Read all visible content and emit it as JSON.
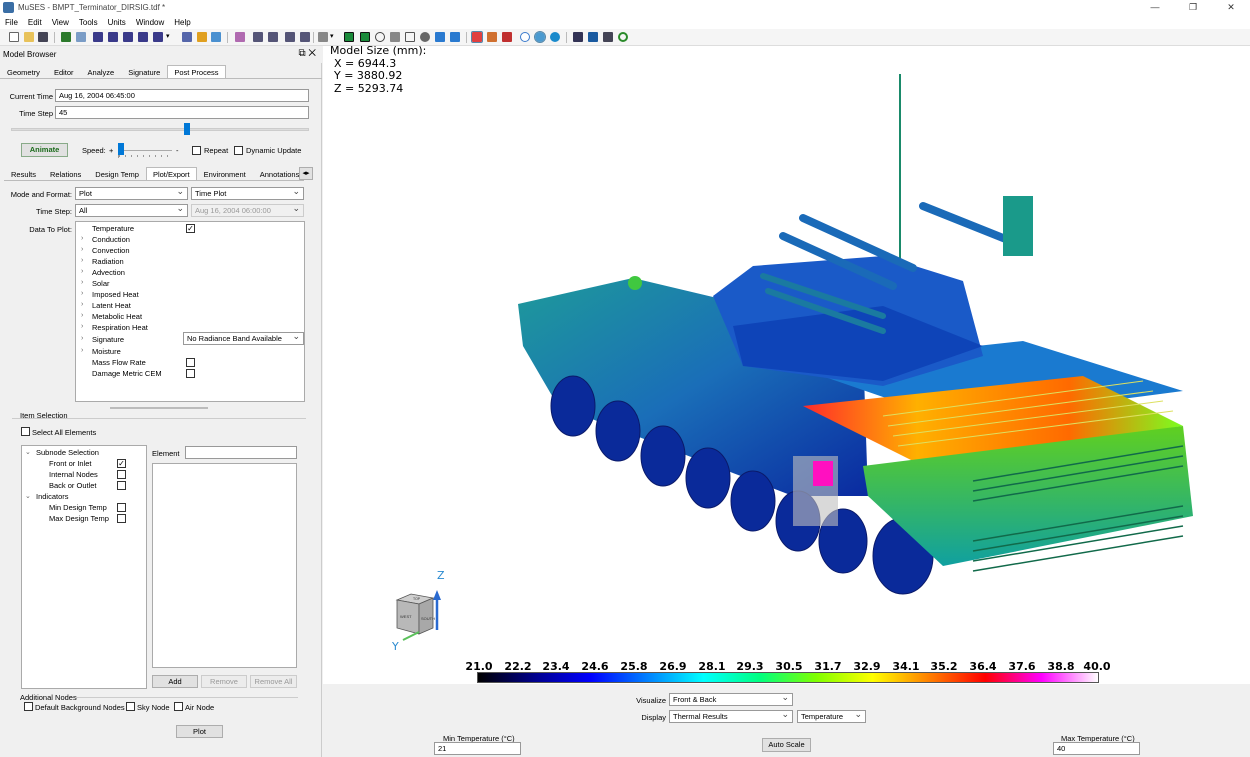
{
  "window": {
    "app_name": "MuSES",
    "title": "MuSES - BMPT_Terminator_DIRSIG.tdf *"
  },
  "menu": [
    "File",
    "Edit",
    "View",
    "Tools",
    "Units",
    "Window",
    "Help"
  ],
  "model_browser": {
    "title": "Model Browser",
    "tabs": [
      "Geometry",
      "Editor",
      "Analyze",
      "Signature",
      "Post Process"
    ],
    "active_tab": "Post Process",
    "current_time_label": "Current Time",
    "current_time_value": "Aug 16, 2004 06:45:00",
    "time_step_label": "Time Step",
    "time_step_value": "45",
    "time_slider_fraction": 0.59,
    "animate_label": "Animate",
    "speed_label": "Speed:",
    "speed_plus": "+",
    "speed_minus": "-",
    "repeat_label": "Repeat",
    "repeat_checked": false,
    "dynamic_update_label": "Dynamic Update",
    "dynamic_update_checked": false,
    "subtabs": [
      "Results",
      "Relations",
      "Design Temp",
      "Plot/Export",
      "Environment",
      "Annotations"
    ],
    "active_subtab": "Plot/Export",
    "mode_format_label": "Mode and Format:",
    "mode_value": "Plot",
    "format_value": "Time Plot",
    "time_step2_label": "Time Step:",
    "time_step2_value": "All",
    "time_step2_date": "Aug 16, 2004 06:00:00",
    "data_to_plot_label": "Data To Plot:",
    "data_items": [
      {
        "label": "Temperature",
        "expander": false,
        "checkbox": true,
        "checked": true
      },
      {
        "label": "Conduction",
        "expander": true
      },
      {
        "label": "Convection",
        "expander": true
      },
      {
        "label": "Radiation",
        "expander": true
      },
      {
        "label": "Advection",
        "expander": true
      },
      {
        "label": "Solar",
        "expander": true
      },
      {
        "label": "Imposed Heat",
        "expander": true
      },
      {
        "label": "Latent Heat",
        "expander": true
      },
      {
        "label": "Metabolic Heat",
        "expander": true
      },
      {
        "label": "Respiration Heat",
        "expander": true
      },
      {
        "label": "Signature",
        "expander": true,
        "dropdown": "No Radiance Band Available"
      },
      {
        "label": "Moisture",
        "expander": true
      },
      {
        "label": "Mass Flow Rate",
        "expander": false,
        "checkbox": true,
        "checked": false
      },
      {
        "label": "Damage Metric CEM",
        "expander": false,
        "checkbox": true,
        "checked": false
      }
    ],
    "item_selection_label": "Item Selection",
    "select_all_label": "Select All Elements",
    "subnode_selection_label": "Subnode Selection",
    "subnodes": [
      {
        "label": "Front or Inlet",
        "checked": true
      },
      {
        "label": "Internal Nodes",
        "checked": false
      },
      {
        "label": "Back or Outlet",
        "checked": false
      }
    ],
    "indicators_label": "Indicators",
    "indicators": [
      {
        "label": "Min Design Temp",
        "checked": false
      },
      {
        "label": "Max Design Temp",
        "checked": false
      }
    ],
    "element_label": "Element",
    "add_label": "Add",
    "remove_label": "Remove",
    "remove_all_label": "Remove All",
    "additional_nodes_label": "Additional Nodes",
    "default_bg_label": "Default Background Nodes",
    "sky_node_label": "Sky Node",
    "air_node_label": "Air Node",
    "plot_label": "Plot"
  },
  "viewport": {
    "model_size_title": "Model Size (mm):",
    "x_line": "X = 6944.3",
    "y_line": "Y = 3880.92",
    "z_line": "Z = 5293.74",
    "axis_z": "Z",
    "axis_y": "Y",
    "cube_top": "TOP",
    "cube_front": "SOUTH",
    "cube_side": "WEST"
  },
  "colorbar": {
    "ticks": [
      "21.0",
      "22.2",
      "23.4",
      "24.6",
      "25.8",
      "26.9",
      "28.1",
      "29.3",
      "30.5",
      "31.7",
      "32.9",
      "34.1",
      "35.2",
      "36.4",
      "37.6",
      "38.8",
      "40.0"
    ],
    "colors": [
      "#000000",
      "#00008b",
      "#0000ff",
      "#0080ff",
      "#00ffff",
      "#00ff80",
      "#80ff00",
      "#ffff00",
      "#ff8000",
      "#ff0000",
      "#ff00ff",
      "#ffffff"
    ]
  },
  "bottom": {
    "visualize_label": "Visualize",
    "visualize_value": "Front & Back",
    "display_label": "Display",
    "display_value": "Thermal Results",
    "display_quantity": "Temperature",
    "min_temp_label": "Min Temperature (°C)",
    "min_temp_value": "21",
    "max_temp_label": "Max Temperature (°C)",
    "max_temp_value": "40",
    "auto_scale_label": "Auto Scale"
  }
}
